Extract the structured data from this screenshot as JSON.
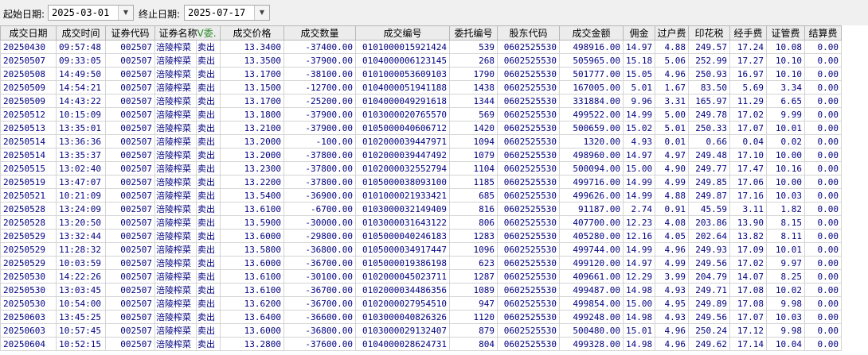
{
  "filter": {
    "start_label": "起始日期:",
    "start_value": "2025-03-01",
    "end_label": "终止日期:",
    "end_value": "2025-07-17",
    "dropdown_icon": "chevron-down-icon"
  },
  "table": {
    "columns": [
      "成交日期",
      "成交时间",
      "证券代码",
      "证券名称",
      "成交价格",
      "成交数量",
      "成交编号",
      "委托编号",
      "股东代码",
      "成交金额",
      "佣金",
      "过户费",
      "印花税",
      "经手费",
      "证管费",
      "结算费"
    ],
    "sorted_column_extra": "V委.",
    "rows": [
      [
        "20250430",
        "09:57:48",
        "002507",
        "涪陵榨菜",
        "卖出",
        "13.3400",
        "-37400.00",
        "0101000015921424",
        "539",
        "0602525530",
        "498916.00",
        "14.97",
        "4.88",
        "249.57",
        "17.24",
        "10.08",
        "0.00"
      ],
      [
        "20250507",
        "09:33:05",
        "002507",
        "涪陵榨菜",
        "卖出",
        "13.3500",
        "-37900.00",
        "0104000006123145",
        "268",
        "0602525530",
        "505965.00",
        "15.18",
        "5.06",
        "252.99",
        "17.27",
        "10.10",
        "0.00"
      ],
      [
        "20250508",
        "14:49:50",
        "002507",
        "涪陵榨菜",
        "卖出",
        "13.1700",
        "-38100.00",
        "0101000053609103",
        "1790",
        "0602525530",
        "501777.00",
        "15.05",
        "4.96",
        "250.93",
        "16.97",
        "10.10",
        "0.00"
      ],
      [
        "20250509",
        "14:54:21",
        "002507",
        "涪陵榨菜",
        "卖出",
        "13.1500",
        "-12700.00",
        "0104000051941188",
        "1438",
        "0602525530",
        "167005.00",
        "5.01",
        "1.67",
        "83.50",
        "5.69",
        "3.34",
        "0.00"
      ],
      [
        "20250509",
        "14:43:22",
        "002507",
        "涪陵榨菜",
        "卖出",
        "13.1700",
        "-25200.00",
        "0104000049291618",
        "1344",
        "0602525530",
        "331884.00",
        "9.96",
        "3.31",
        "165.97",
        "11.29",
        "6.65",
        "0.00"
      ],
      [
        "20250512",
        "10:15:09",
        "002507",
        "涪陵榨菜",
        "卖出",
        "13.1800",
        "-37900.00",
        "0103000020765570",
        "569",
        "0602525530",
        "499522.00",
        "14.99",
        "5.00",
        "249.78",
        "17.02",
        "9.99",
        "0.00"
      ],
      [
        "20250513",
        "13:35:01",
        "002507",
        "涪陵榨菜",
        "卖出",
        "13.2100",
        "-37900.00",
        "0105000040606712",
        "1420",
        "0602525530",
        "500659.00",
        "15.02",
        "5.01",
        "250.33",
        "17.07",
        "10.01",
        "0.00"
      ],
      [
        "20250514",
        "13:36:36",
        "002507",
        "涪陵榨菜",
        "卖出",
        "13.2000",
        "-100.00",
        "0102000039447971",
        "1094",
        "0602525530",
        "1320.00",
        "4.93",
        "0.01",
        "0.66",
        "0.04",
        "0.02",
        "0.00"
      ],
      [
        "20250514",
        "13:35:37",
        "002507",
        "涪陵榨菜",
        "卖出",
        "13.2000",
        "-37800.00",
        "0102000039447492",
        "1079",
        "0602525530",
        "498960.00",
        "14.97",
        "4.97",
        "249.48",
        "17.10",
        "10.00",
        "0.00"
      ],
      [
        "20250515",
        "13:02:40",
        "002507",
        "涪陵榨菜",
        "卖出",
        "13.2300",
        "-37800.00",
        "0102000032552794",
        "1104",
        "0602525530",
        "500094.00",
        "15.00",
        "4.90",
        "249.77",
        "17.47",
        "10.16",
        "0.00"
      ],
      [
        "20250519",
        "13:47:07",
        "002507",
        "涪陵榨菜",
        "卖出",
        "13.2200",
        "-37800.00",
        "0105000038093100",
        "1185",
        "0602525530",
        "499716.00",
        "14.99",
        "4.99",
        "249.85",
        "17.06",
        "10.00",
        "0.00"
      ],
      [
        "20250521",
        "10:21:09",
        "002507",
        "涪陵榨菜",
        "卖出",
        "13.5400",
        "-36900.00",
        "0101000021933421",
        "685",
        "0602525530",
        "499626.00",
        "14.99",
        "4.88",
        "249.87",
        "17.16",
        "10.03",
        "0.00"
      ],
      [
        "20250528",
        "13:24:09",
        "002507",
        "涪陵榨菜",
        "卖出",
        "13.6100",
        "-6700.00",
        "0103000032149409",
        "816",
        "0602525530",
        "91187.00",
        "2.74",
        "0.91",
        "45.59",
        "3.11",
        "1.82",
        "0.00"
      ],
      [
        "20250528",
        "13:20:50",
        "002507",
        "涪陵榨菜",
        "卖出",
        "13.5900",
        "-30000.00",
        "0103000031643122",
        "806",
        "0602525530",
        "407700.00",
        "12.23",
        "4.08",
        "203.86",
        "13.90",
        "8.15",
        "0.00"
      ],
      [
        "20250529",
        "13:32:44",
        "002507",
        "涪陵榨菜",
        "卖出",
        "13.6000",
        "-29800.00",
        "0105000040246183",
        "1283",
        "0602525530",
        "405280.00",
        "12.16",
        "4.05",
        "202.64",
        "13.82",
        "8.11",
        "0.00"
      ],
      [
        "20250529",
        "11:28:32",
        "002507",
        "涪陵榨菜",
        "卖出",
        "13.5800",
        "-36800.00",
        "0105000034917447",
        "1096",
        "0602525530",
        "499744.00",
        "14.99",
        "4.96",
        "249.93",
        "17.09",
        "10.01",
        "0.00"
      ],
      [
        "20250529",
        "10:03:59",
        "002507",
        "涪陵榨菜",
        "卖出",
        "13.6000",
        "-36700.00",
        "0105000019386198",
        "623",
        "0602525530",
        "499120.00",
        "14.97",
        "4.99",
        "249.56",
        "17.02",
        "9.97",
        "0.00"
      ],
      [
        "20250530",
        "14:22:26",
        "002507",
        "涪陵榨菜",
        "卖出",
        "13.6100",
        "-30100.00",
        "0102000045023711",
        "1287",
        "0602525530",
        "409661.00",
        "12.29",
        "3.99",
        "204.79",
        "14.07",
        "8.25",
        "0.00"
      ],
      [
        "20250530",
        "13:03:45",
        "002507",
        "涪陵榨菜",
        "卖出",
        "13.6100",
        "-36700.00",
        "0102000034486356",
        "1089",
        "0602525530",
        "499487.00",
        "14.98",
        "4.93",
        "249.71",
        "17.08",
        "10.02",
        "0.00"
      ],
      [
        "20250530",
        "10:54:00",
        "002507",
        "涪陵榨菜",
        "卖出",
        "13.6200",
        "-36700.00",
        "0102000027954510",
        "947",
        "0602525530",
        "499854.00",
        "15.00",
        "4.95",
        "249.89",
        "17.08",
        "9.98",
        "0.00"
      ],
      [
        "20250603",
        "13:45:25",
        "002507",
        "涪陵榨菜",
        "卖出",
        "13.6400",
        "-36600.00",
        "0103000040826326",
        "1120",
        "0602525530",
        "499248.00",
        "14.98",
        "4.93",
        "249.56",
        "17.07",
        "10.03",
        "0.00"
      ],
      [
        "20250603",
        "10:57:45",
        "002507",
        "涪陵榨菜",
        "卖出",
        "13.6000",
        "-36800.00",
        "0103000029132407",
        "879",
        "0602525530",
        "500480.00",
        "15.01",
        "4.96",
        "250.24",
        "17.12",
        "9.98",
        "0.00"
      ],
      [
        "20250604",
        "10:52:15",
        "002507",
        "涪陵榨菜",
        "卖出",
        "13.2800",
        "-37600.00",
        "0104000028624731",
        "804",
        "0602525530",
        "499328.00",
        "14.98",
        "4.96",
        "249.62",
        "17.14",
        "10.04",
        "0.00"
      ]
    ]
  }
}
